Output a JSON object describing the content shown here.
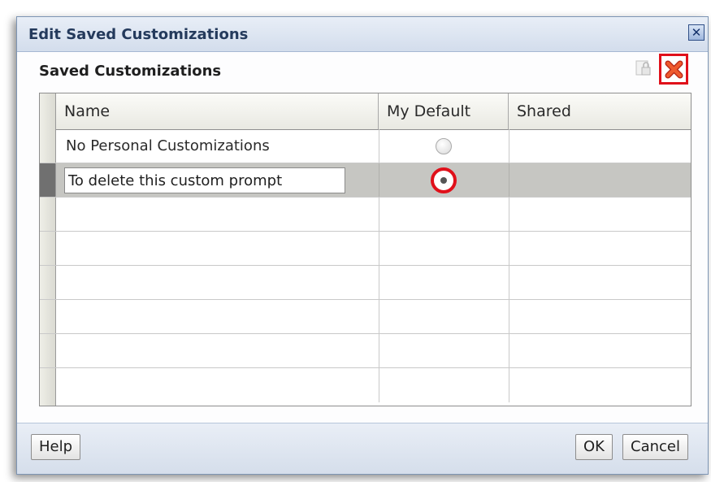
{
  "dialog": {
    "title": "Edit Saved Customizations",
    "close_icon": "close-icon"
  },
  "section": {
    "title": "Saved Customizations",
    "lock_icon": "lock-icon",
    "delete_icon": "delete-icon"
  },
  "table": {
    "columns": [
      "Name",
      "My Default",
      "Shared"
    ],
    "rows": [
      {
        "name": "No Personal Customizations",
        "my_default": false,
        "shared": ""
      },
      {
        "name": "To delete this custom prompt",
        "my_default": true,
        "shared": ""
      }
    ]
  },
  "footer": {
    "help_label": "Help",
    "ok_label": "OK",
    "cancel_label": "Cancel"
  },
  "colors": {
    "highlight": "#e0101a",
    "selected_row": "#c6c6c2",
    "titlebar": "#d3ddec"
  }
}
